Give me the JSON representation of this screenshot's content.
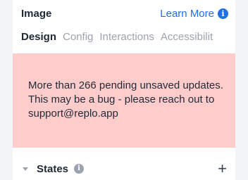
{
  "header": {
    "title": "Image",
    "learn_more": "Learn More",
    "info_icon": "i"
  },
  "tabs": [
    {
      "label": "Design",
      "active": true
    },
    {
      "label": "Config",
      "active": false
    },
    {
      "label": "Interactions",
      "active": false
    },
    {
      "label": "Accessibilit",
      "active": false
    }
  ],
  "error": {
    "message": "More than 266 pending unsaved updates. This may be a bug - please reach out to support@replo.app",
    "background": "#ffcccc"
  },
  "states": {
    "label": "States",
    "info_icon": "i",
    "add_icon": "+"
  },
  "colors": {
    "accent": "#1f6fe5",
    "text": "#1f2937",
    "muted": "#9ca3af"
  }
}
